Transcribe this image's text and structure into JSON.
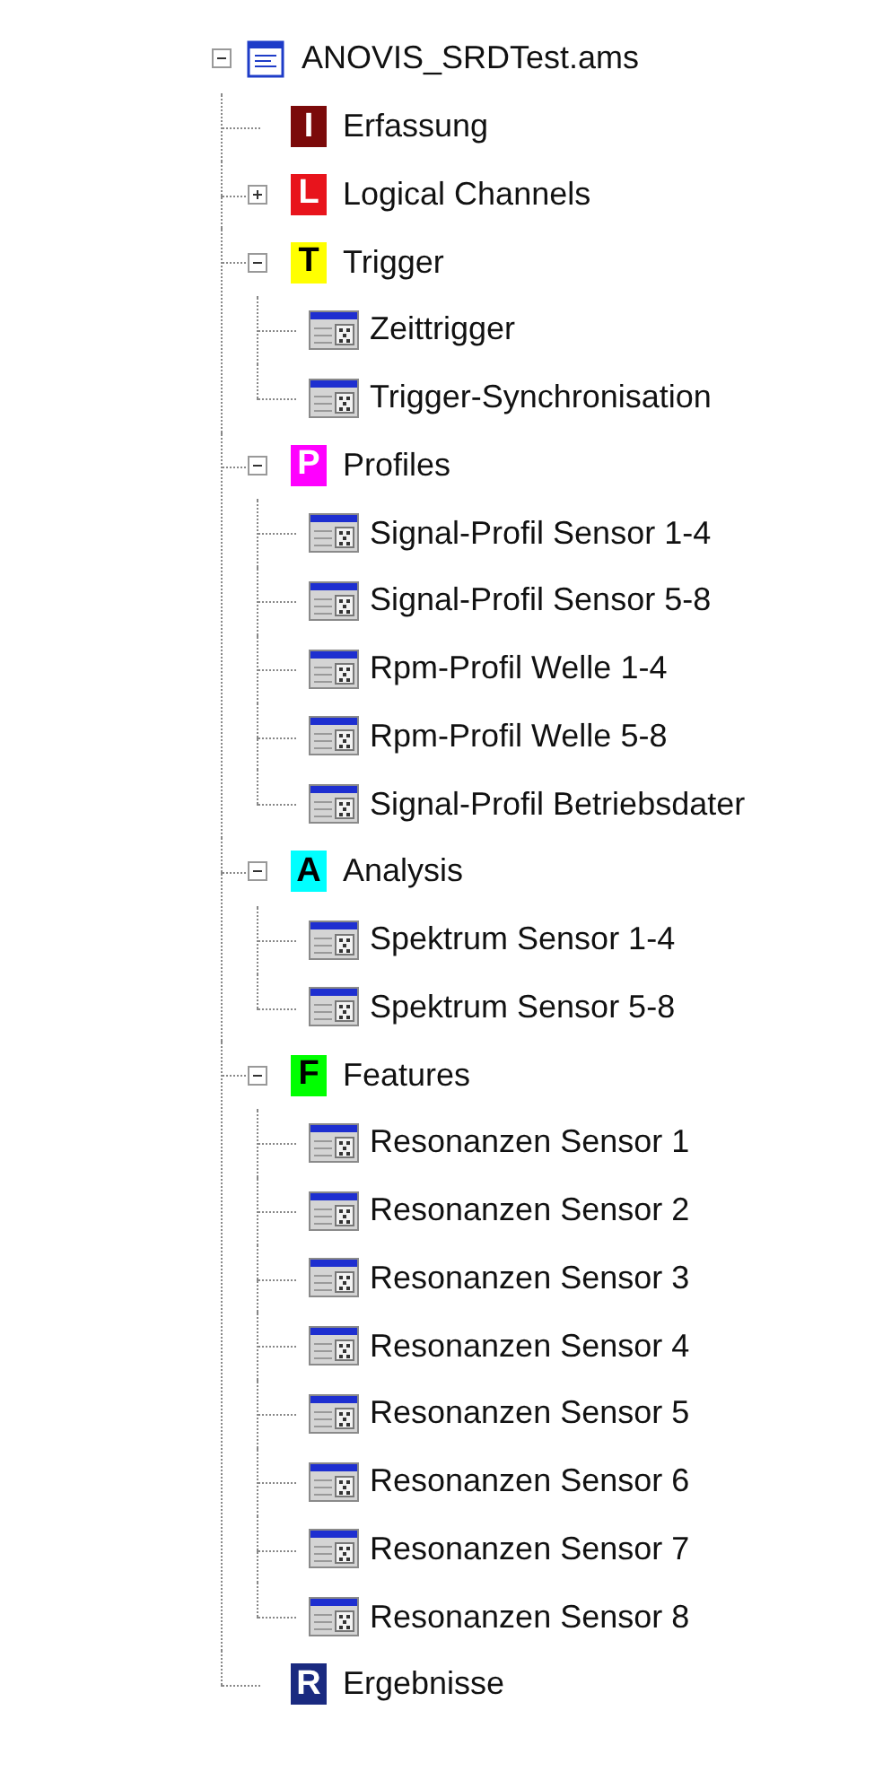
{
  "tree": {
    "label": "ANOVIS_SRDTest.ams",
    "expanded": true,
    "children": [
      {
        "kind": "category",
        "badge": "I",
        "color": "#7b0a0a",
        "label": "Erfassung"
      },
      {
        "kind": "category",
        "badge": "L",
        "color": "#e8141c",
        "label": "Logical Channels",
        "expanded": false
      },
      {
        "kind": "category",
        "badge": "T",
        "color": "#ffff00",
        "label": "Trigger",
        "expanded": true,
        "children": [
          {
            "kind": "item",
            "label": "Zeittrigger"
          },
          {
            "kind": "item",
            "label": "Trigger-Synchronisation"
          }
        ]
      },
      {
        "kind": "category",
        "badge": "P",
        "color": "#ff00ff",
        "label": "Profiles",
        "expanded": true,
        "children": [
          {
            "kind": "item",
            "label": "Signal-Profil Sensor 1-4"
          },
          {
            "kind": "item",
            "label": "Signal-Profil Sensor 5-8"
          },
          {
            "kind": "item",
            "label": "Rpm-Profil Welle 1-4"
          },
          {
            "kind": "item",
            "label": "Rpm-Profil Welle 5-8"
          },
          {
            "kind": "item",
            "label": "Signal-Profil Betriebsdater"
          }
        ]
      },
      {
        "kind": "category",
        "badge": "A",
        "color": "#00ffff",
        "label": "Analysis",
        "expanded": true,
        "children": [
          {
            "kind": "item",
            "label": "Spektrum Sensor 1-4"
          },
          {
            "kind": "item",
            "label": "Spektrum Sensor 5-8"
          }
        ]
      },
      {
        "kind": "category",
        "badge": "F",
        "color": "#00ff00",
        "label": "Features",
        "expanded": true,
        "children": [
          {
            "kind": "item",
            "label": "Resonanzen Sensor 1"
          },
          {
            "kind": "item",
            "label": "Resonanzen Sensor 2"
          },
          {
            "kind": "item",
            "label": "Resonanzen Sensor 3"
          },
          {
            "kind": "item",
            "label": "Resonanzen Sensor 4"
          },
          {
            "kind": "item",
            "label": "Resonanzen Sensor 5"
          },
          {
            "kind": "item",
            "label": "Resonanzen Sensor 6"
          },
          {
            "kind": "item",
            "label": "Resonanzen Sensor 7"
          },
          {
            "kind": "item",
            "label": "Resonanzen Sensor 8"
          }
        ]
      },
      {
        "kind": "category",
        "badge": "R",
        "color": "#1a2a80",
        "label": "Ergebnisse"
      }
    ]
  }
}
